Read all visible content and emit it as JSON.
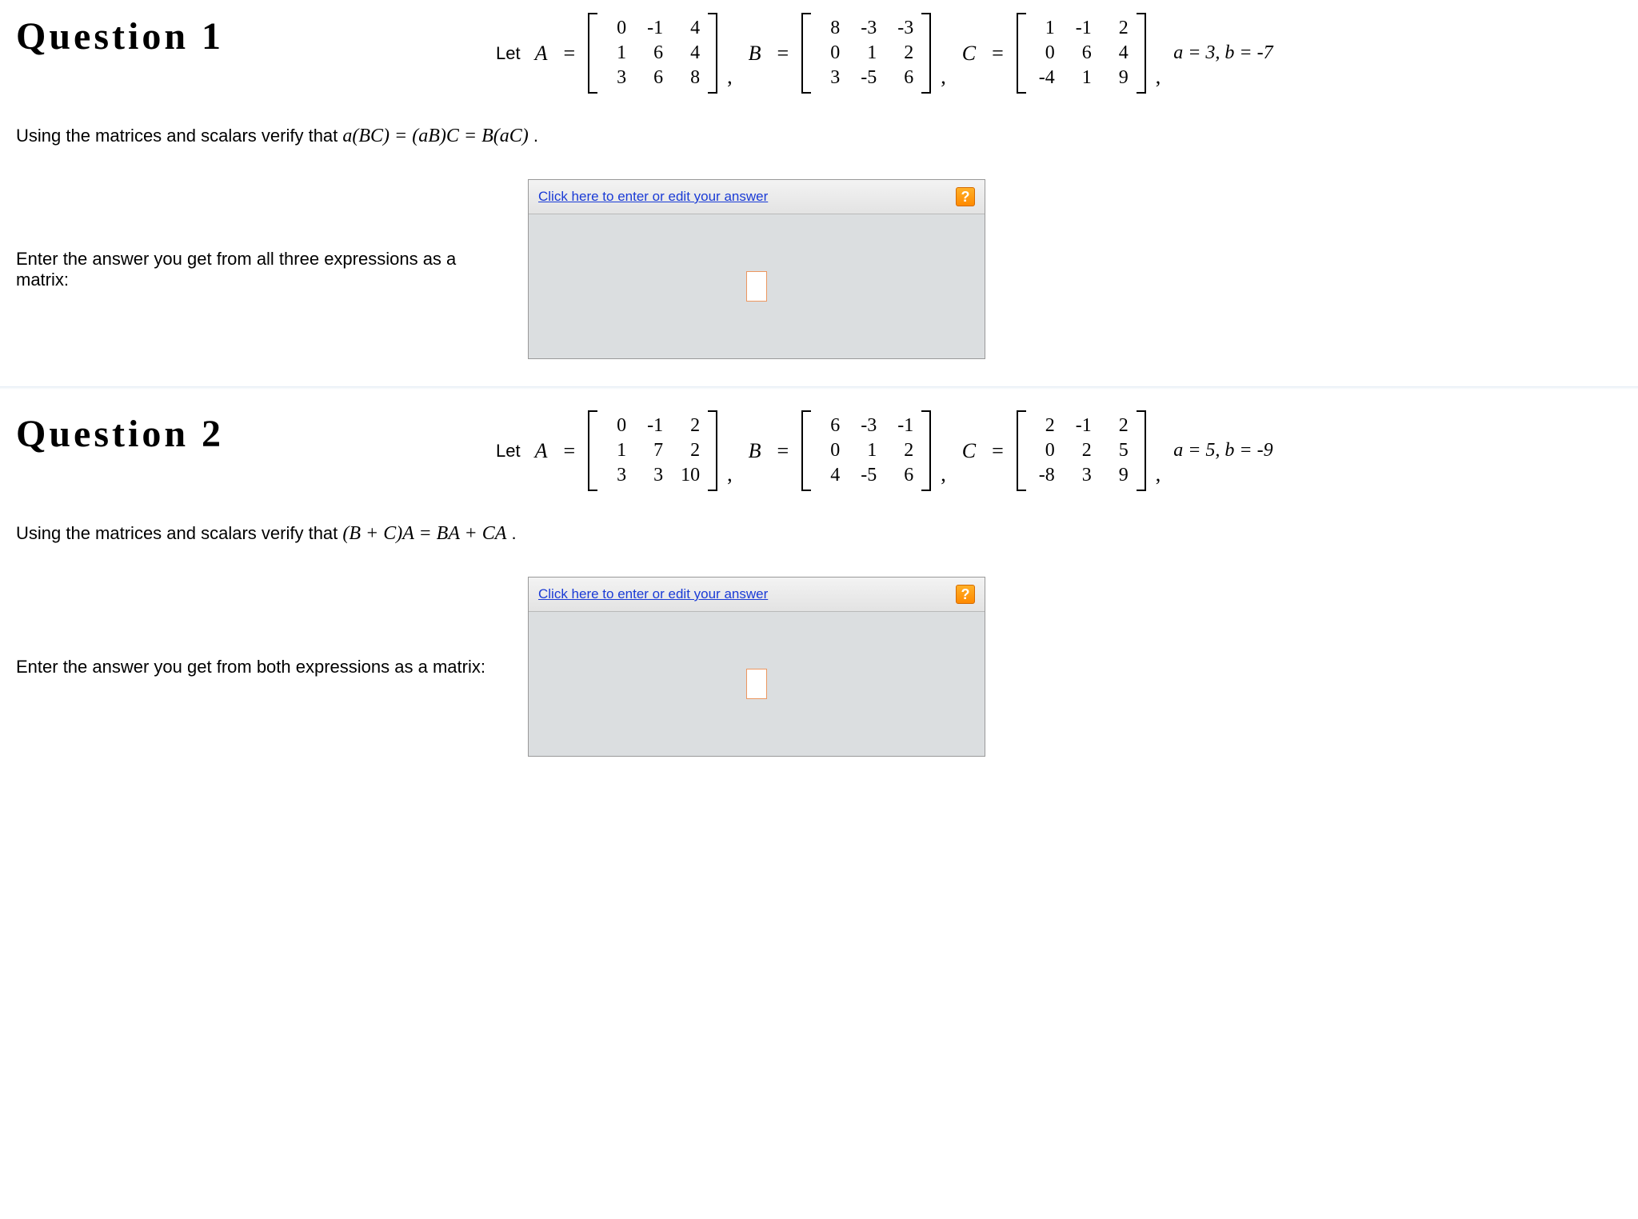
{
  "questions": [
    {
      "title": "Question 1",
      "let_label": "Let",
      "matrices": {
        "A": {
          "name": "A",
          "rows": [
            [
              "0",
              "-1",
              "4"
            ],
            [
              "1",
              "6",
              "4"
            ],
            [
              "3",
              "6",
              "8"
            ]
          ]
        },
        "B": {
          "name": "B",
          "rows": [
            [
              "8",
              "-3",
              "-3"
            ],
            [
              "0",
              "1",
              "2"
            ],
            [
              "3",
              "-5",
              "6"
            ]
          ]
        },
        "C": {
          "name": "C",
          "rows": [
            [
              "1",
              "-1",
              "2"
            ],
            [
              "0",
              "6",
              "4"
            ],
            [
              "-4",
              "1",
              "9"
            ]
          ]
        }
      },
      "scalars_text": "a = 3, b = -7",
      "instruction_prefix": "Using the matrices and scalars verify that ",
      "instruction_math": "a(BC) = (aB)C = B(aC)",
      "instruction_suffix": " .",
      "answer_prompt": "Enter the answer you get from all three expressions as a matrix:",
      "panel_link": "Click here to enter or edit your answer",
      "help_symbol": "?"
    },
    {
      "title": "Question 2",
      "let_label": "Let",
      "matrices": {
        "A": {
          "name": "A",
          "rows": [
            [
              "0",
              "-1",
              "2"
            ],
            [
              "1",
              "7",
              "2"
            ],
            [
              "3",
              "3",
              "10"
            ]
          ]
        },
        "B": {
          "name": "B",
          "rows": [
            [
              "6",
              "-3",
              "-1"
            ],
            [
              "0",
              "1",
              "2"
            ],
            [
              "4",
              "-5",
              "6"
            ]
          ]
        },
        "C": {
          "name": "C",
          "rows": [
            [
              "2",
              "-1",
              "2"
            ],
            [
              "0",
              "2",
              "5"
            ],
            [
              "-8",
              "3",
              "9"
            ]
          ]
        }
      },
      "scalars_text": "a = 5, b = -9",
      "instruction_prefix": "Using the matrices and scalars verify that ",
      "instruction_math": "(B + C)A = BA + CA",
      "instruction_suffix": " .",
      "answer_prompt": "Enter the answer you get from both expressions as a matrix:",
      "panel_link": "Click here to enter or edit your answer",
      "help_symbol": "?"
    }
  ],
  "eq_sign": "=",
  "comma": ","
}
